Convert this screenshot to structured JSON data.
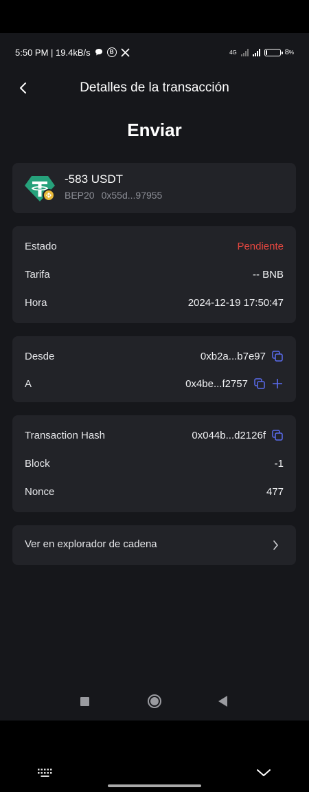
{
  "status_bar": {
    "time_speed": "5:50 PM | 19.4kB/s",
    "network": "4G",
    "battery_text": "8",
    "battery_percent_sign": "%",
    "battery_level": 0.08
  },
  "header": {
    "title": "Detalles de la transacción"
  },
  "page_title": "Enviar",
  "asset": {
    "amount": "-583 USDT",
    "network": "BEP20",
    "address": "0x55d...97955",
    "icon": "usdt-token-icon",
    "badge_icon": "bnb-chain-badge-icon"
  },
  "details": {
    "rows": [
      {
        "label": "Estado",
        "value": "Pendiente"
      },
      {
        "label": "Tarifa",
        "value": "-- BNB"
      },
      {
        "label": "Hora",
        "value": "2024-12-19 17:50:47"
      }
    ]
  },
  "addresses": {
    "rows": [
      {
        "label": "Desde",
        "value": "0xb2a...b7e97"
      },
      {
        "label": "A",
        "value": "0x4be...f2757"
      }
    ]
  },
  "chain_info": {
    "rows": [
      {
        "label": "Transaction Hash",
        "value": "0x044b...d2126f"
      },
      {
        "label": "Block",
        "value": "-1"
      },
      {
        "label": "Nonce",
        "value": "477"
      }
    ]
  },
  "explorer": {
    "label": "Ver en explorador de cadena"
  },
  "colors": {
    "background": "#16171b",
    "card": "#222328",
    "pending": "#e2463f",
    "accent": "#5b6cf0",
    "usdt": "#26a17b"
  }
}
